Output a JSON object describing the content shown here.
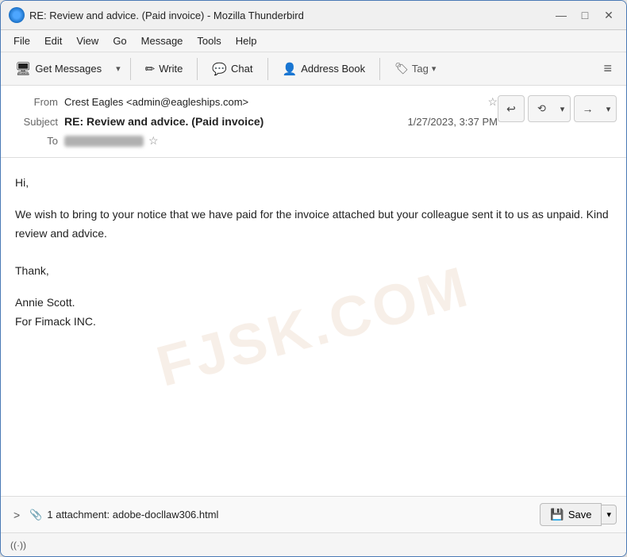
{
  "window": {
    "title": "RE: Review and advice. (Paid invoice) - Mozilla Thunderbird",
    "minimize_label": "—",
    "maximize_label": "□",
    "close_label": "✕"
  },
  "menubar": {
    "items": [
      "File",
      "Edit",
      "View",
      "Go",
      "Message",
      "Tools",
      "Help"
    ]
  },
  "toolbar": {
    "get_messages_label": "Get Messages",
    "write_label": "Write",
    "chat_label": "Chat",
    "address_book_label": "Address Book",
    "tag_label": "Tag",
    "dropdown_arrow": "▾",
    "hamburger": "≡"
  },
  "email": {
    "from_label": "From",
    "from_value": "Crest Eagles <admin@eagleships.com>",
    "subject_label": "Subject",
    "subject_value": "RE: Review and advice. (Paid invoice)",
    "date_value": "1/27/2023, 3:37 PM",
    "to_label": "To",
    "body_greeting": "Hi,",
    "body_paragraph": "   We wish to bring to your notice that we have paid for the invoice attached but your colleague sent it to us as unpaid. Kind review and advice.",
    "body_closing": "Thank,",
    "body_name": "Annie Scott.",
    "body_org": "For Fimack INC."
  },
  "action_buttons": {
    "reply": "↩",
    "reply_all": "↩",
    "dropdown": "▾",
    "forward": "→",
    "more": "▾"
  },
  "attachment": {
    "toggle": ">",
    "paperclip": "📎",
    "count_text": "1 attachment: adobe-docllaw306.html",
    "save_label": "Save",
    "save_dropdown": "▾"
  },
  "statusbar": {
    "signal_icon": "((·))"
  },
  "watermark": "FJSK.COM"
}
